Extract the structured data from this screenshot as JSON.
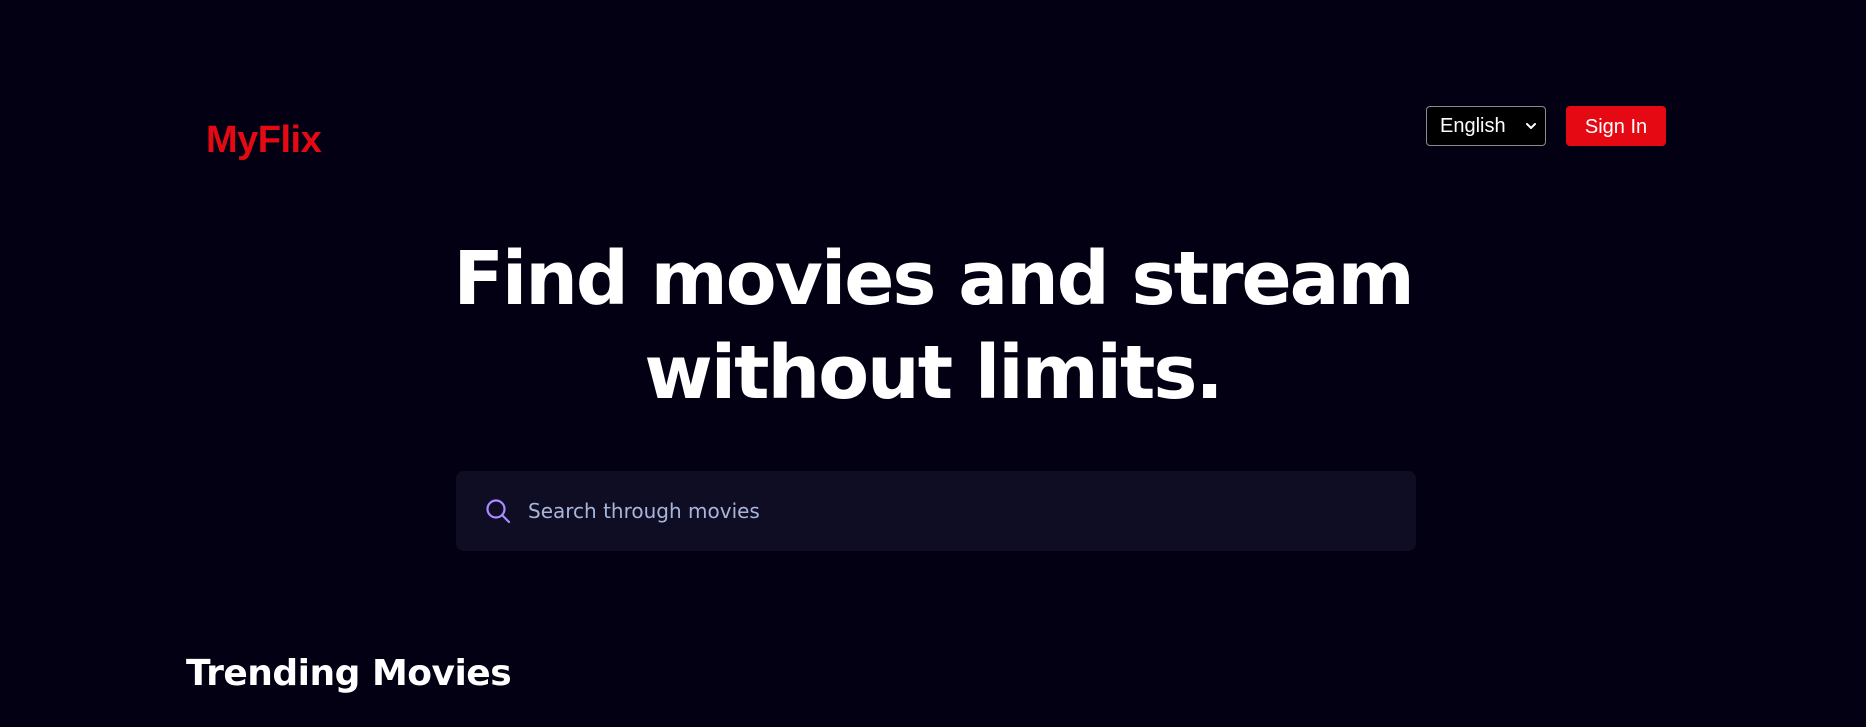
{
  "header": {
    "logo_text": "MyFlix",
    "language": {
      "selected": "English",
      "icon": "chevron-down-icon"
    },
    "sign_in_label": "Sign In"
  },
  "hero": {
    "line1": "Find movies and stream",
    "line2": "without limits."
  },
  "search": {
    "placeholder": "Search through movies",
    "value": "",
    "icon": "search-icon"
  },
  "trending": {
    "heading": "Trending Movies"
  },
  "colors": {
    "background": "#030014",
    "brand": "#e50914",
    "search_bg": "#0f0d23",
    "search_accent": "#ab8bff",
    "placeholder": "#a8b5db",
    "text": "#ffffff"
  }
}
